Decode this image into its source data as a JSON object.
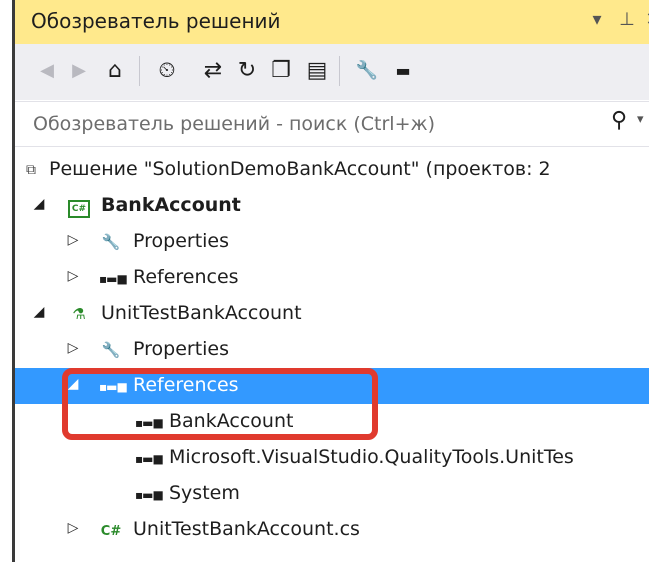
{
  "window": {
    "title": "Обозреватель решений",
    "controls": {
      "dropdown": "▾",
      "pin": "⊥",
      "close": "✕"
    }
  },
  "toolbar": {
    "buttons": [
      {
        "name": "back-icon",
        "glyph": "◀",
        "enabled": false
      },
      {
        "name": "forward-icon",
        "glyph": "▶",
        "enabled": false
      },
      {
        "name": "home-icon",
        "glyph": "⌂",
        "enabled": true
      },
      {
        "name": "pending-changes-filter-icon",
        "glyph": "⏲",
        "enabled": true
      },
      {
        "name": "sync-with-active-document-icon",
        "glyph": "⇄",
        "enabled": true
      },
      {
        "name": "refresh-icon",
        "glyph": "↻",
        "enabled": true
      },
      {
        "name": "collapse-all-icon",
        "glyph": "❐",
        "enabled": true
      },
      {
        "name": "show-all-files-icon",
        "glyph": "▤",
        "enabled": true
      },
      {
        "name": "properties-icon",
        "glyph": "🔧",
        "enabled": true
      },
      {
        "name": "pin-preview-icon",
        "glyph": "▬",
        "enabled": true
      }
    ]
  },
  "search": {
    "placeholder": "Обозреватель решений - поиск (Ctrl+ж)"
  },
  "tree": {
    "solution": "Решение \"SolutionDemoBankAccount\" (проектов: 2",
    "project1": {
      "name": "BankAccount",
      "properties": "Properties",
      "references": "References"
    },
    "project2": {
      "name": "UnitTestBankAccount",
      "properties": "Properties",
      "references": "References",
      "reference_items": [
        "BankAccount",
        "Microsoft.VisualStudio.QualityTools.UnitTes",
        "System"
      ],
      "file": "UnitTestBankAccount.cs"
    }
  },
  "colors": {
    "titlebar": "#ffe98c",
    "selection": "#3399ff",
    "highlight_outline": "#e03a2e"
  }
}
